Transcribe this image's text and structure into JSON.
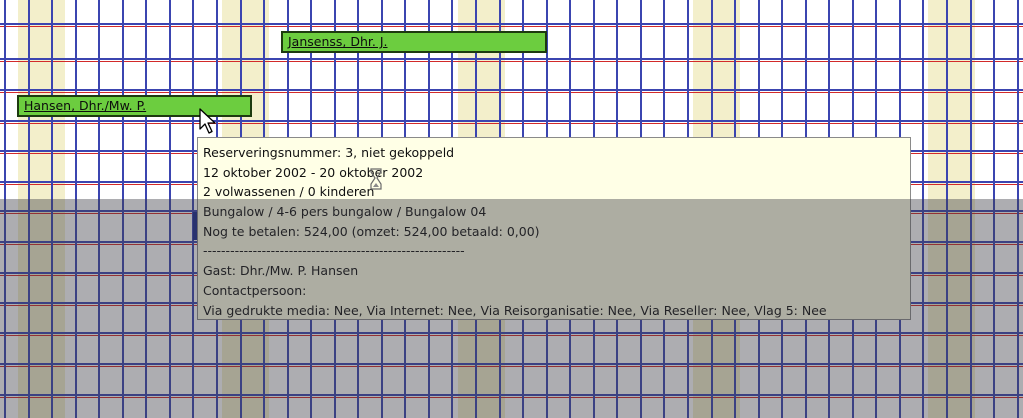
{
  "planner": {
    "colors": {
      "background": "#ffffff",
      "weekend_column": "#f3efcb",
      "grid_blue": "#3b45b0",
      "grid_red": "#d22a2a",
      "booking_fill": "#6ccd3f",
      "booking_border": "#1d3a0f",
      "tooltip_bg": "#ffffe6"
    },
    "bookings": [
      {
        "label": "Jansenss, Dhr. J."
      },
      {
        "label": "Hansen, Dhr./Mw. P."
      }
    ]
  },
  "tooltip": {
    "lines": [
      "Reserveringsnummer: 3, niet gekoppeld",
      "12 oktober 2002 - 20 oktober 2002",
      "2 volwassenen / 0 kinderen",
      "Bungalow / 4-6 pers bungalow / Bungalow 04",
      "Nog te betalen: 524,00 (omzet: 524,00  betaald: 0,00)",
      "----------------------------------------------------------",
      "Gast: Dhr./Mw. P. Hansen",
      "Contactpersoon:",
      "Via gedrukte media: Nee, Via Internet: Nee, Via Reisorganisatie: Nee, Via Reseller: Nee, Vlag 5: Nee"
    ]
  },
  "icons": {
    "mouse_pointer": "arrow-cursor-icon",
    "hourglass": "busy-cursor-icon"
  }
}
